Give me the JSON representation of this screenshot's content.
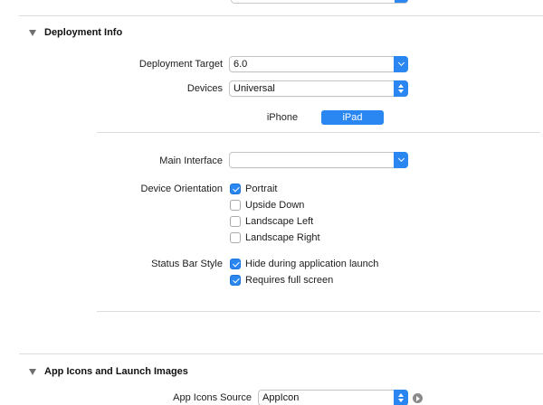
{
  "deployment": {
    "title": "Deployment Info",
    "deployment_target_label": "Deployment Target",
    "deployment_target_value": "6.0",
    "devices_label": "Devices",
    "devices_value": "Universal",
    "device_tabs": [
      {
        "label": "iPhone",
        "active": false
      },
      {
        "label": "iPad",
        "active": true
      }
    ],
    "main_interface_label": "Main Interface",
    "main_interface_value": "",
    "orientation_label": "Device Orientation",
    "orientations": [
      {
        "label": "Portrait",
        "checked": true
      },
      {
        "label": "Upside Down",
        "checked": false
      },
      {
        "label": "Landscape Left",
        "checked": false
      },
      {
        "label": "Landscape Right",
        "checked": false
      }
    ],
    "status_bar_label": "Status Bar Style",
    "status_bar_options": [
      {
        "label": "Hide during application launch",
        "checked": true
      },
      {
        "label": "Requires full screen",
        "checked": true
      }
    ]
  },
  "app_icons": {
    "title": "App Icons and Launch Images",
    "icons_source_label": "App Icons Source",
    "icons_source_value": "AppIcon"
  },
  "colors": {
    "accent": "#2a86f0",
    "separator": "#dcdcdc"
  }
}
